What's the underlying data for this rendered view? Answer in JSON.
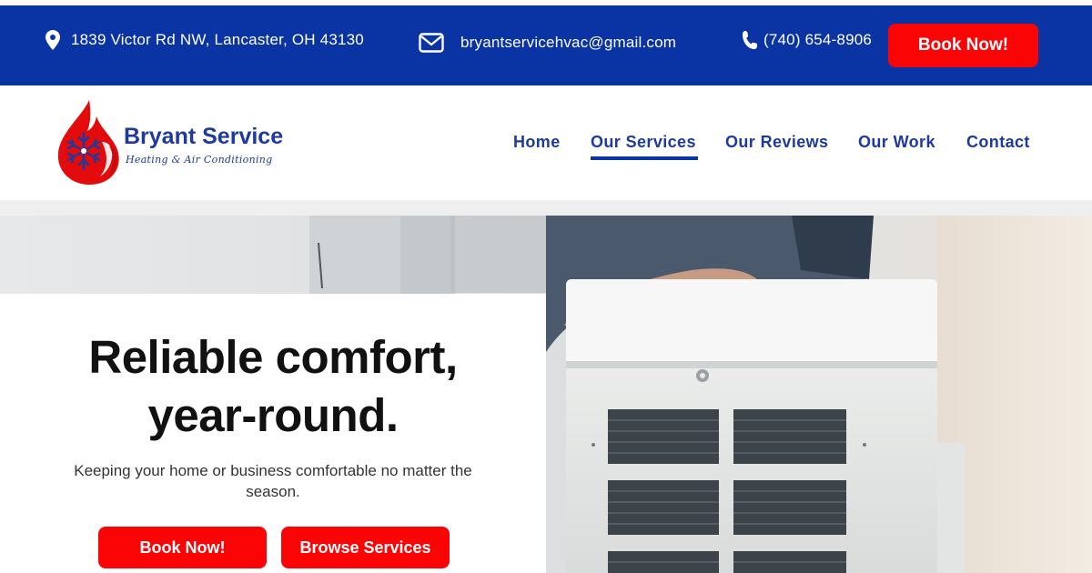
{
  "topbar": {
    "address": "1839 Victor Rd NW, Lancaster, OH 43130",
    "address_icon": "location-pin-icon",
    "email": "bryantservicehvac@gmail.com",
    "email_icon": "envelope-icon",
    "phone": "(740) 654-8906",
    "phone_icon": "phone-icon",
    "book_label": "Book Now!"
  },
  "brand": {
    "name": "Bryant Service",
    "tagline": "Heating & Air Conditioning",
    "logo_icon": "flame-snowflake-logo"
  },
  "nav": {
    "items": [
      {
        "label": "Home"
      },
      {
        "label": "Our Services",
        "active": true
      },
      {
        "label": "Our Reviews"
      },
      {
        "label": "Our Work"
      },
      {
        "label": "Contact"
      }
    ]
  },
  "hero": {
    "title_line1": "Reliable comfort,",
    "title_line2": "year-round.",
    "subtitle": "Keeping your home or business comfortable no matter the season.",
    "primary_button": "Book Now!",
    "secondary_button": "Browse Services"
  },
  "colors": {
    "brand_blue": "#0a34a3",
    "cta_red": "#fb0406",
    "nav_text": "#1d3a9c"
  }
}
